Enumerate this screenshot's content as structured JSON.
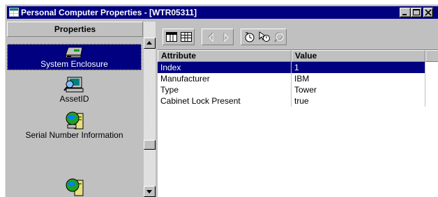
{
  "window": {
    "title": "Personal Computer Properties - [WTR05311]",
    "title_bar_color": "#000080",
    "selection_color": "#000080"
  },
  "left_panel": {
    "header": "Properties",
    "items": [
      {
        "label": "System Enclosure",
        "icon": "system-enclosure-icon",
        "selected": true
      },
      {
        "label": "AssetID",
        "icon": "computer-search-icon",
        "selected": false
      },
      {
        "label": "Serial Number Information",
        "icon": "network-globe-server-icon",
        "selected": false
      },
      {
        "label": "",
        "icon": "network-globe-server-icon",
        "selected": false
      }
    ]
  },
  "toolbar": {
    "buttons": [
      "table-view-icon",
      "grid-view-icon",
      "back-icon",
      "forward-icon",
      "refresh-clock-icon",
      "cursor-timer-icon",
      "find-icon"
    ]
  },
  "grid": {
    "columns": [
      "Attribute",
      "Value"
    ],
    "rows": [
      {
        "attribute": "Index",
        "value": "1",
        "selected": true
      },
      {
        "attribute": "Manufacturer",
        "value": "IBM",
        "selected": false
      },
      {
        "attribute": "Type",
        "value": "Tower",
        "selected": false
      },
      {
        "attribute": "Cabinet Lock Present",
        "value": "true",
        "selected": false
      }
    ]
  }
}
